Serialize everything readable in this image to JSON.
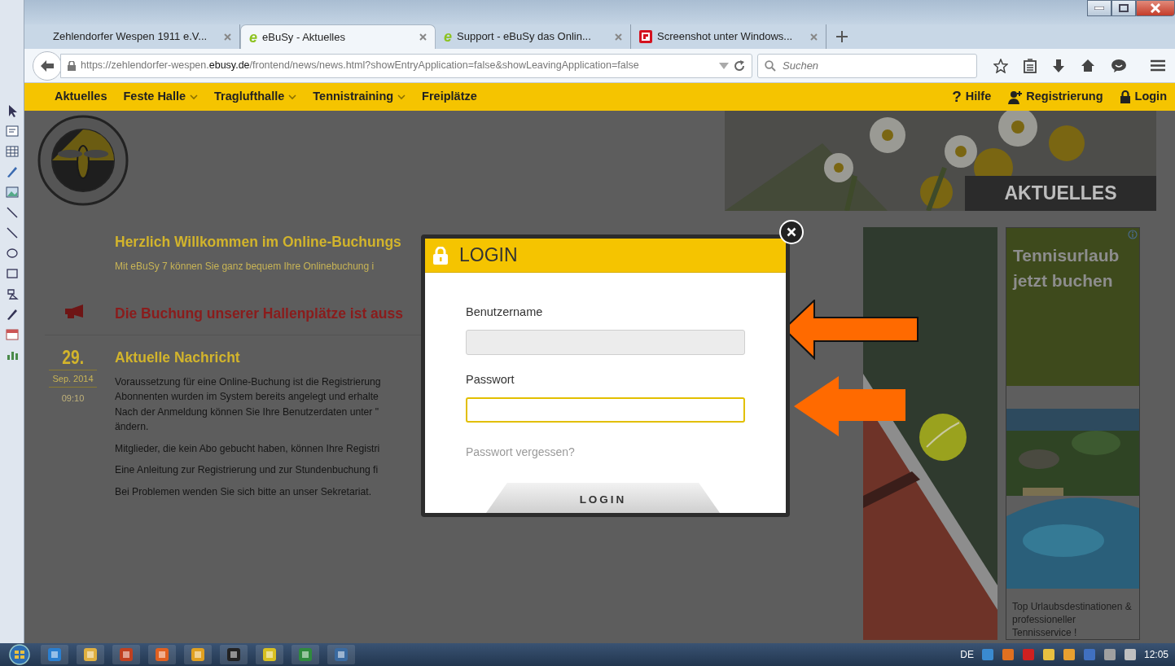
{
  "browser": {
    "tabs": [
      {
        "title": "Zehlendorfer Wespen 1911 e.V...",
        "selected": false
      },
      {
        "title": "eBuSy - Aktuelles",
        "selected": true,
        "favicon": {
          "kind": "letter",
          "text": "e"
        }
      },
      {
        "title": "Support - eBuSy das Onlin...",
        "selected": false,
        "favicon": {
          "kind": "letter",
          "text": "e"
        }
      },
      {
        "title": "Screenshot unter Windows...",
        "selected": false,
        "favicon": {
          "kind": "square"
        }
      }
    ],
    "address": {
      "start": "https://zehlendorfer-wespen.",
      "domain": "ebusy.de",
      "path": "/frontend/news/news.html?showEntryApplication=false&showLeavingApplication=false"
    },
    "search": {
      "placeholder": "Suchen"
    }
  },
  "site": {
    "nav": [
      {
        "label": "Aktuelles",
        "dropdown": false
      },
      {
        "label": "Feste Halle",
        "dropdown": true
      },
      {
        "label": "Traglufthalle",
        "dropdown": true
      },
      {
        "label": "Tennistraining",
        "dropdown": true
      },
      {
        "label": "Freiplätze",
        "dropdown": false
      }
    ],
    "links": [
      {
        "kind": "help",
        "icon_text": "?",
        "label": "Hilfe"
      },
      {
        "kind": "register",
        "label": "Registrierung"
      },
      {
        "kind": "login",
        "label": "Login"
      }
    ],
    "banner_label": "AKTUELLES",
    "welcome": {
      "title": "Herzlich Willkommen im Online-Buchungs",
      "subtitle": "Mit eBuSy 7 können Sie ganz bequem Ihre Onlinebuchung i"
    },
    "notice": "Die Buchung unserer Hallenplätze ist auss",
    "post": {
      "day": "29.",
      "month_year": "Sep. 2014",
      "time": "09:10",
      "title": "Aktuelle Nachricht",
      "paragraphs": [
        [
          "Voraussetzung für eine Online-Buchung ist die Registrierung",
          "Abonnenten wurden im System bereits angelegt und erhalte",
          "Nach der Anmeldung können Sie Ihre Benutzerdaten unter \"",
          "ändern."
        ],
        [
          "Mitglieder, die kein Abo gebucht haben, können Ihre Registri"
        ],
        [
          "Eine Anleitung zur Registrierung und zur Stundenbuchung fi"
        ],
        [
          "Bei Problemen wenden Sie sich bitte an unser Sekretariat."
        ]
      ]
    }
  },
  "ad": {
    "headline": "Tennisurlaub jetzt buchen",
    "caption": "Top Urlaubsdestinationen & professioneller Tennisservice !"
  },
  "login_dialog": {
    "title": "LOGIN",
    "fields": [
      {
        "label": "Benutzername",
        "focused": false
      },
      {
        "label": "Passwort",
        "focused": true
      }
    ],
    "forgot_link": "Passwort vergessen?",
    "submit": "LOGIN"
  },
  "taskbar": {
    "language": "DE",
    "clock": "12:05"
  }
}
